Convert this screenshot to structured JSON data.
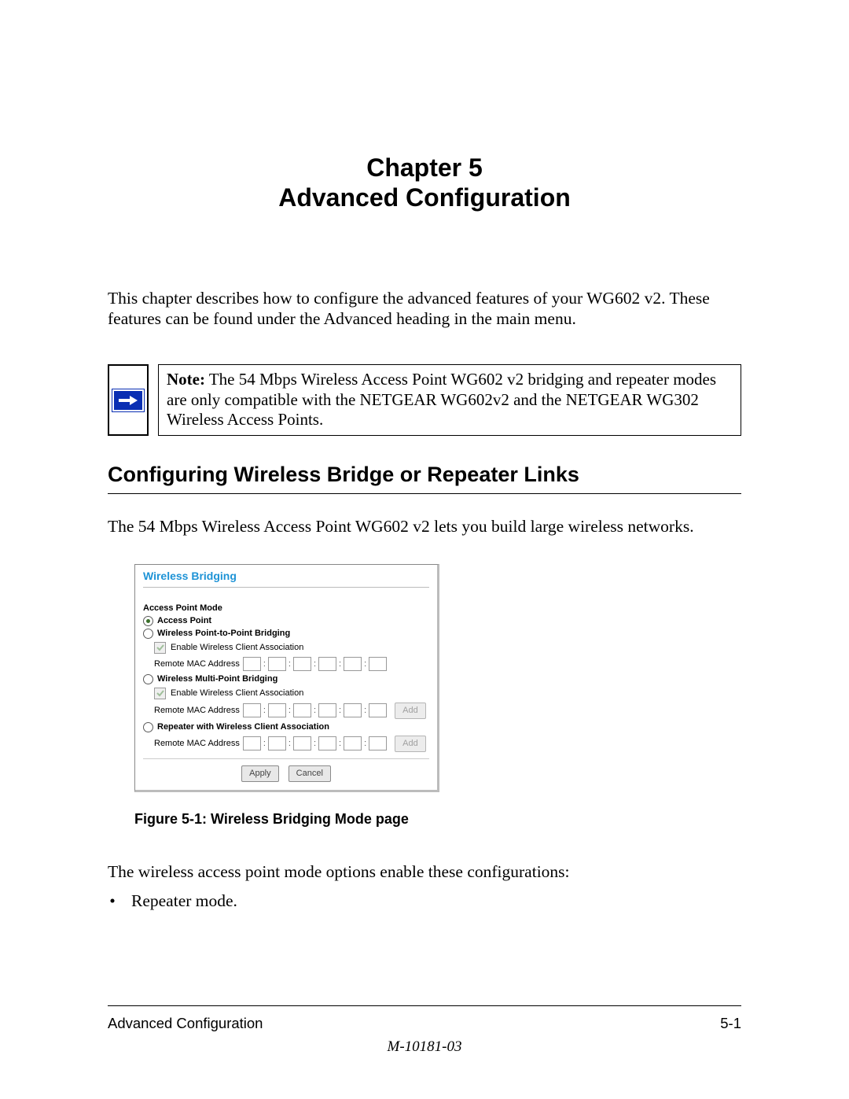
{
  "chapter": {
    "line1": "Chapter 5",
    "line2": "Advanced Configuration"
  },
  "intro": "This chapter describes how to configure the advanced features of your WG602 v2. These features can be found under the Advanced heading in the main menu.",
  "note": {
    "label": "Note:",
    "text": " The 54 Mbps Wireless Access Point WG602 v2 bridging and repeater modes are only compatible with the NETGEAR WG602v2 and the NETGEAR WG302 Wireless Access Points."
  },
  "section_h": "Configuring Wireless Bridge or Repeater Links",
  "section_intro": "The 54 Mbps Wireless Access Point WG602 v2 lets you build large wireless networks.",
  "shot": {
    "title": "Wireless Bridging",
    "mode_heading": "Access Point Mode",
    "options": {
      "ap": "Access Point",
      "ptp": "Wireless Point-to-Point Bridging",
      "mp": "Wireless Multi-Point Bridging",
      "rep": "Repeater with Wireless Client Association"
    },
    "enable_assoc": "Enable Wireless Client Association",
    "remote_mac": "Remote MAC Address",
    "buttons": {
      "add": "Add",
      "apply": "Apply",
      "cancel": "Cancel"
    }
  },
  "fig_caption": "Figure 5-1: Wireless Bridging Mode page",
  "options_intro": "The wireless access point mode options enable these configurations:",
  "bullets": [
    "Repeater mode."
  ],
  "footer": {
    "left": "Advanced Configuration",
    "right": "5-1",
    "doc_id": "M-10181-03"
  }
}
